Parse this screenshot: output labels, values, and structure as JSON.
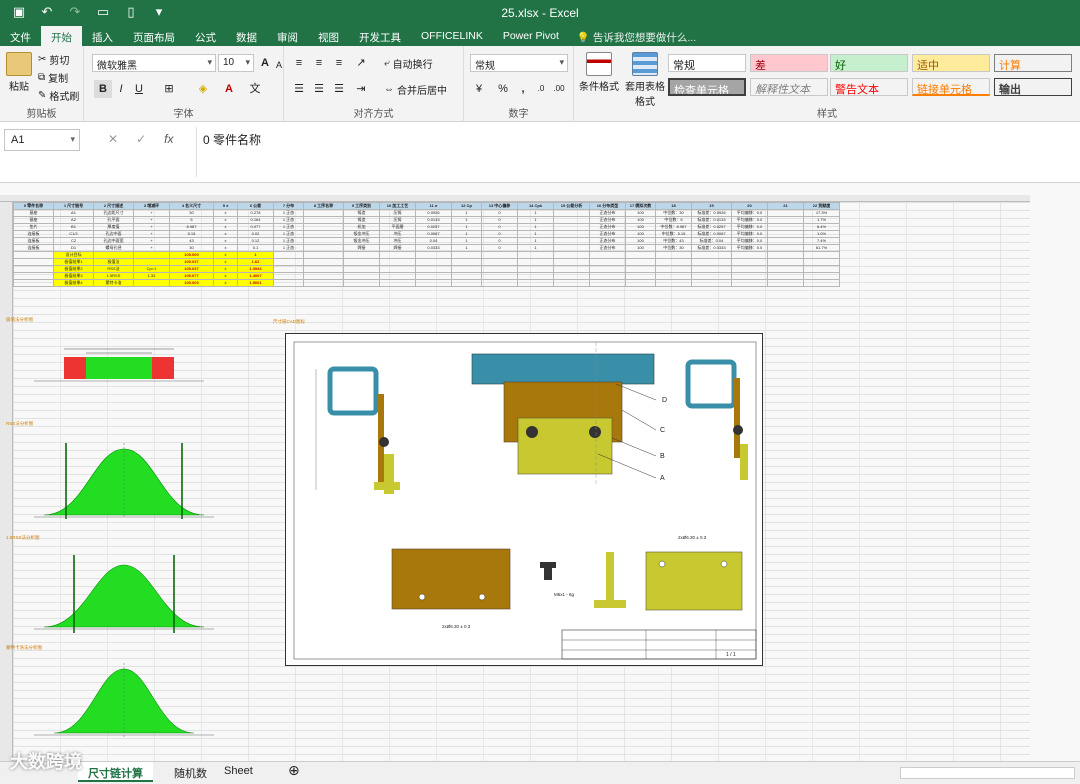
{
  "window": {
    "title": "25.xlsx - Excel"
  },
  "ribbon_tabs": [
    "文件",
    "开始",
    "插入",
    "页面布局",
    "公式",
    "数据",
    "审阅",
    "视图",
    "开发工具",
    "OFFICELINK",
    "Power Pivot"
  ],
  "active_tab": "开始",
  "tell_me": "告诉我您想要做什么...",
  "clipboard": {
    "paste": "粘贴",
    "cut": "剪切",
    "copy": "复制",
    "format_painter": "格式刷",
    "label": "剪贴板"
  },
  "font": {
    "name": "微软雅黑",
    "size": "10",
    "label": "字体",
    "bold": "B",
    "italic": "I",
    "underline": "U",
    "grow": "A",
    "shrink": "A"
  },
  "alignment": {
    "wrap": "自动换行",
    "merge": "合并后居中",
    "label": "对齐方式"
  },
  "number": {
    "format": "常规",
    "label": "数字",
    "percent": "%",
    "comma": ","
  },
  "styles": {
    "conditional": "条件格式",
    "table_format": "套用表格格式",
    "label": "样式",
    "cells": [
      "常规",
      "差",
      "好",
      "适中",
      "计算",
      "检查单元格",
      "解释性文本",
      "警告文本",
      "链接单元格",
      "输出"
    ]
  },
  "formula_bar": {
    "name_box": "A1",
    "cancel": "✕",
    "enter": "✓",
    "fx": "fx",
    "formula": "0 零件名称"
  },
  "colors": {
    "excel_green": "#217346",
    "header_blue": "#bcd6ea",
    "highlight_yellow": "#ffff00",
    "chart_green": "#22dd22",
    "chart_red": "#ee3333",
    "part_teal": "#3a8fa8",
    "part_brown": "#a8780c",
    "part_olive": "#c8c830"
  },
  "sheet": {
    "column_headers": [
      "0 零件名称",
      "1 尺寸链号",
      "2 尺寸描述",
      "3 增减环",
      "4 名义尺寸",
      "5 ±",
      "6 公差",
      "7 分布",
      "8 工序名称",
      "9 工序类别",
      "10 加工工艺",
      "11 σ",
      "12 Cp",
      "13 中心偏移",
      "14 Cpk",
      "15 公差分析",
      "16 分布类型",
      "17 模拟次数",
      "18",
      "19",
      "20",
      "21",
      "22 贡献度"
    ],
    "rows": [
      [
        "基座",
        "A1",
        "孔边距尺寸",
        "+",
        "30",
        "±",
        "0.278",
        "1 正态",
        "",
        "铸造",
        "压铸",
        "0.0926",
        "1",
        "0",
        "1",
        "",
        "正态分布",
        "100",
        "中位数：30",
        "标准差：0.0926",
        "平均偏移：0.0",
        "",
        "17.3%"
      ],
      [
        "基座",
        "A2",
        "孔平面",
        "+",
        "5",
        "±",
        "0.164",
        "1 正态",
        "",
        "铸造",
        "压铸",
        "0.0133",
        "1",
        "0",
        "1",
        "",
        "正态分布",
        "100",
        "中位数：5",
        "标准差：0.0133",
        "平均偏移：0.0",
        "",
        "1.7%"
      ],
      [
        "垫片",
        "B1",
        "厚度值",
        "+",
        "8.987",
        "±",
        "0.077",
        "1 正态",
        "",
        "机加",
        "平面磨",
        "0.0257",
        "1",
        "0",
        "1",
        "",
        "正态分布",
        "100",
        "中位数：8.987",
        "标准差：0.0257",
        "平均偏移：0.0",
        "",
        "6.4%"
      ],
      [
        "连接板",
        "C1/2",
        "孔边中面",
        "+",
        "5.15",
        "±",
        "0.02",
        "1 正态",
        "",
        "钣金冲压",
        "冲压",
        "0.0067",
        "1",
        "0",
        "1",
        "",
        "正态分布",
        "100",
        "中位数：5.15",
        "标准差：0.0067",
        "平均偏移：0.0",
        "",
        "1.0%"
      ],
      [
        "连接板",
        "C2",
        "孔边中面宽",
        "+",
        "43",
        "±",
        "0.12",
        "1 正态",
        "",
        "钣金冲压",
        "冲压",
        "0.04",
        "1",
        "0",
        "1",
        "",
        "正态分布",
        "100",
        "中位数：43",
        "标准差：0.04",
        "平均偏移：0.0",
        "",
        "7.4%"
      ],
      [
        "连接板",
        "D1",
        "螺母孔径",
        "+",
        "30",
        "±",
        "0.1",
        "1 正态",
        "",
        "焊接",
        "焊接",
        "0.0333",
        "1",
        "0",
        "1",
        "",
        "正态分布",
        "100",
        "中位数：30",
        "标准差：0.0333",
        "平均偏移：0.0",
        "",
        "61.7%"
      ]
    ],
    "summary": [
      [
        "设计目标",
        "",
        "",
        "100.000",
        "±",
        "1"
      ],
      [
        "极值结果1",
        "极值法",
        "",
        "100.037",
        "±",
        "1.62"
      ],
      [
        "极值结果2",
        "RSS法",
        "Cp=1",
        "100.037",
        "±",
        "1.3944"
      ],
      [
        "极值结果3",
        "1.5RSS",
        "1.33",
        "100.077",
        "±",
        "1.4007"
      ],
      [
        "极值结果4",
        "蒙特卡洛",
        "",
        "100.003",
        "±",
        "1.5001"
      ]
    ]
  },
  "mini_charts": [
    "极值法分析图",
    "RSS法分析图",
    "1.5RSS法分析图",
    "蒙特卡洛法分析图"
  ],
  "drawing": {
    "caption": "尺寸链CAD图标",
    "part_labels": [
      "D",
      "C",
      "B",
      "A"
    ],
    "hole_callouts": [
      "2xØ6.30 ± 0.3",
      "2xØ6.30 ± 0.3"
    ],
    "bolt": "M6x1 - 6g",
    "frame_numbers": [
      "1",
      "2",
      "3",
      "4",
      "5",
      "6",
      "7",
      "8"
    ],
    "frame_letters": [
      "A",
      "B",
      "C",
      "D"
    ],
    "sheet_no": "1 / 1"
  },
  "sheet_tabs": [
    "尺寸链计算",
    "随机数",
    "Sheet"
  ],
  "watermark": "大数跨境"
}
